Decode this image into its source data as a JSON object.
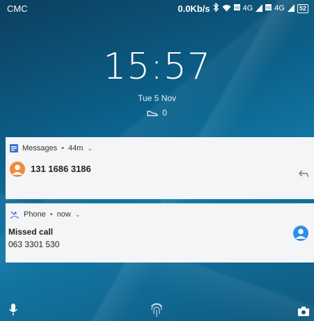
{
  "status_bar": {
    "carrier": "CMC",
    "network_speed": "0.0Kb/s",
    "signal_text_1": "4G",
    "signal_text_2": "4G",
    "battery": "52",
    "icons": [
      "bluetooth-icon",
      "wifi-icon",
      "hd-icon",
      "signal-icon",
      "hd-icon",
      "signal-icon",
      "battery-icon"
    ]
  },
  "lockscreen": {
    "time": "15:57",
    "date": "Tue 5 Nov",
    "steps": "0"
  },
  "notifications": {
    "messages": {
      "app": "Messages",
      "separator": "•",
      "age": "44m",
      "title": "131 1686 3186",
      "icons": [
        "messages-app-icon",
        "chevron-down-icon",
        "contact-avatar-icon",
        "reply-icon"
      ]
    },
    "phone": {
      "app": "Phone",
      "separator": "•",
      "age": "now",
      "title": "Missed call",
      "number": "063 3301 530",
      "icons": [
        "missed-call-icon",
        "chevron-down-icon",
        "contact-avatar-icon"
      ]
    }
  },
  "bottom_bar": {
    "icons": [
      "microphone-icon",
      "fingerprint-icon",
      "camera-icon"
    ]
  },
  "colors": {
    "message_avatar": "#f08a3c",
    "contact_avatar": "#2f8fe6",
    "card_bg": "#f4f5f6",
    "app_icon_blue": "#3a6fd8"
  }
}
